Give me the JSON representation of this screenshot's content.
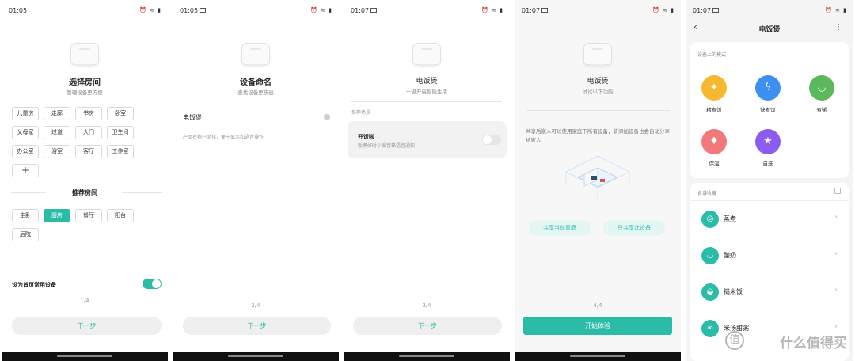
{
  "screen1": {
    "time": "01:05",
    "title": "选择房间",
    "subtitle": "管理设备更方便",
    "rooms": [
      "儿童房",
      "走廊",
      "书房",
      "卧室",
      "父母家",
      "过道",
      "大门",
      "卫生间",
      "办公室",
      "浴室",
      "客厅",
      "工作室"
    ],
    "add": "+",
    "recommended_title": "推荐房间",
    "recommended": [
      "主卧",
      "厨房",
      "餐厅",
      "阳台",
      "后院"
    ],
    "selected_room": "厨房",
    "common_device_label": "设为首页常用设备",
    "common_device_on": true,
    "page": "1/4",
    "next": "下一步"
  },
  "screen2": {
    "time": "01:05",
    "title": "设备命名",
    "subtitle": "查找设备更快速",
    "name_value": "电饭煲",
    "hint": "产品名称已简化，便于显示和语音操作",
    "page": "2/4",
    "next": "下一步"
  },
  "screen3": {
    "time": "01:07",
    "title": "电饭煲",
    "subtitle": "一键开启智能生活",
    "scene_header": "推荐场景",
    "scene_title": "开饭啦",
    "scene_desc": "饭煮好时小爱音箱语音通知",
    "scene_on": false,
    "page": "3/4",
    "next": "下一步"
  },
  "screen4": {
    "time": "01:07",
    "title": "电饭煲",
    "subtitle": "试试以下功能",
    "share_text": "共享后家人可以使用家庭下所有设备，新添加设备也会自动分享给家人",
    "share_home": "共享当前家庭",
    "share_device": "只共享此设备",
    "page": "4/4",
    "start": "开始体验"
  },
  "screen5": {
    "time": "01:07",
    "title": "电饭煲",
    "modes_header": "设备上的模式",
    "modes": [
      {
        "label": "精煮饭",
        "color": "#f5b82e",
        "icon": "sparkle-icon"
      },
      {
        "label": "快煮饭",
        "color": "#3d8ff0",
        "icon": "lightning-icon"
      },
      {
        "label": "煮粥",
        "color": "#5cb85c",
        "icon": "bowl-icon"
      },
      {
        "label": "保温",
        "color": "#f2787a",
        "icon": "drop-icon"
      },
      {
        "label": "自选",
        "color": "#8a5cf0",
        "icon": "star-icon"
      }
    ],
    "recipes_header": "食谱收藏",
    "recipes": [
      "蒸煮",
      "酸奶",
      "糙米饭",
      "米汤甜粥"
    ],
    "watermark": "什么值得买"
  }
}
